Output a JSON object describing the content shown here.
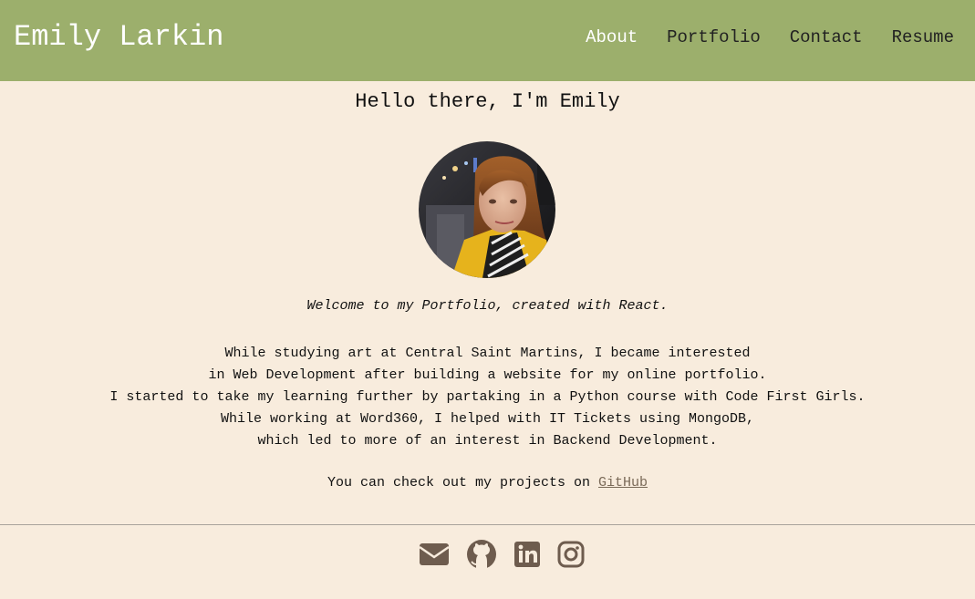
{
  "header": {
    "brand": "Emily Larkin",
    "nav": [
      {
        "label": "About",
        "active": true
      },
      {
        "label": "Portfolio",
        "active": false
      },
      {
        "label": "Contact",
        "active": false
      },
      {
        "label": "Resume",
        "active": false
      }
    ]
  },
  "main": {
    "heading": "Hello there, I'm Emily",
    "welcome": "Welcome to my Portfolio, created with React.",
    "bio_lines": [
      "While studying art at Central Saint Martins, I became interested",
      "in Web Development after building a website for my online portfolio.",
      "I started to take my learning further by partaking in a Python course with Code First Girls.",
      "While working at Word360, I helped with IT Tickets using MongoDB,",
      "which led to more of an interest in Backend Development."
    ],
    "projects_prefix": "You can check out my projects on ",
    "projects_link": "GitHub"
  },
  "footer": {
    "icons": [
      "envelope-icon",
      "github-icon",
      "linkedin-icon",
      "instagram-icon"
    ]
  },
  "colors": {
    "header_bg": "#9caf6c",
    "page_bg": "#f8ecdd",
    "icon": "#6e5c4e",
    "link": "#7a6a58"
  }
}
